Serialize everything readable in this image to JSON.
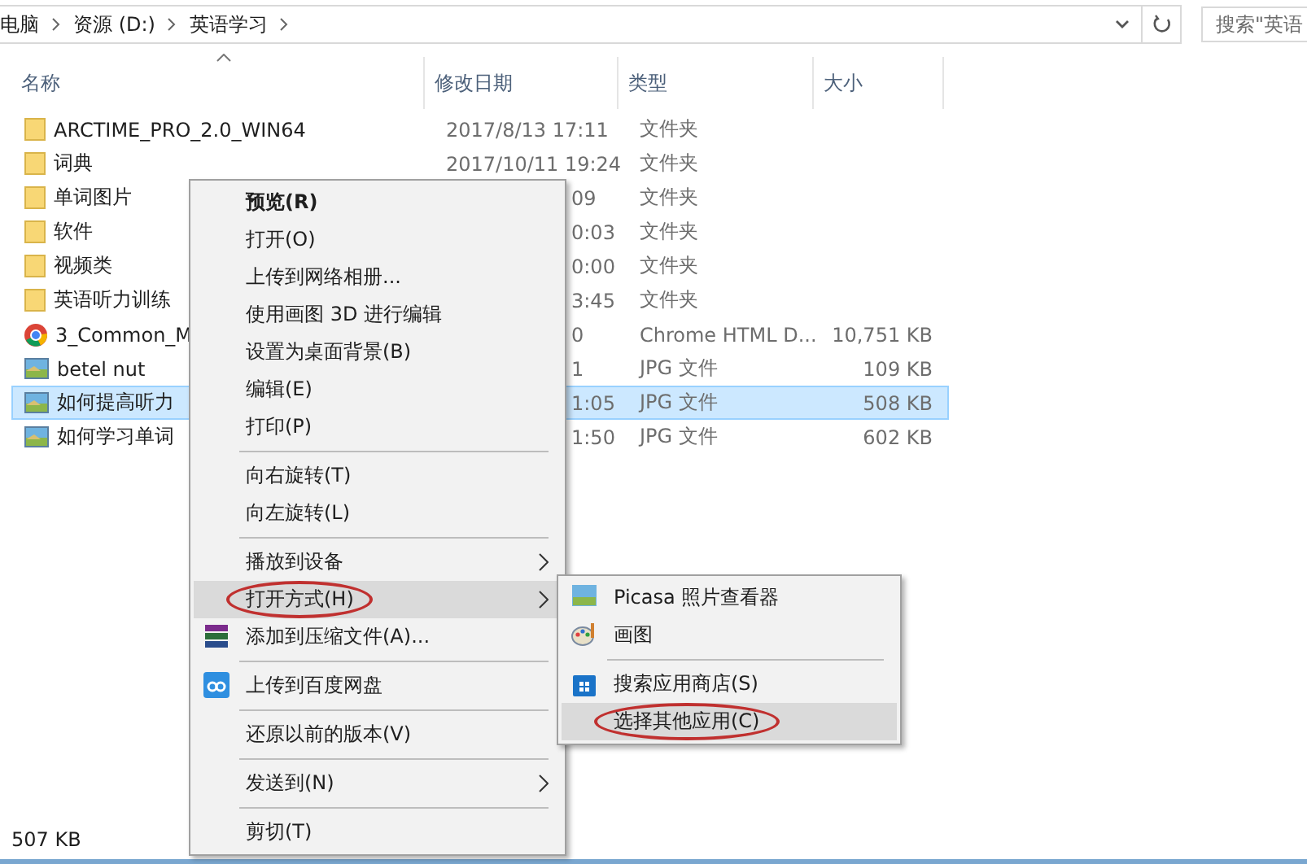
{
  "address_bar": {
    "path": [
      "电脑",
      "资源 (D:)",
      "英语学习"
    ]
  },
  "search": {
    "placeholder": "搜索\"英语"
  },
  "columns": [
    {
      "label": "名称",
      "sorted": true
    },
    {
      "label": "修改日期",
      "sorted": false
    },
    {
      "label": "类型",
      "sorted": false
    },
    {
      "label": "大小",
      "sorted": false
    }
  ],
  "files": [
    {
      "kind": "folder",
      "name": "ARCTIME_PRO_2.0_WIN64",
      "date": "2017/8/13 17:11",
      "type": "文件夹",
      "selected": false
    },
    {
      "kind": "folder",
      "name": "词典",
      "date": "2017/10/11 19:24",
      "type": "文件夹",
      "selected": false
    },
    {
      "kind": "folder",
      "name": "单词图片",
      "date": "09",
      "type": "文件夹",
      "selected": false
    },
    {
      "kind": "folder",
      "name": "软件",
      "date": "0:03",
      "type": "文件夹",
      "selected": false
    },
    {
      "kind": "folder",
      "name": "视频类",
      "date": "0:00",
      "type": "文件夹",
      "selected": false
    },
    {
      "kind": "folder",
      "name": "英语听力训练",
      "date": "3:45",
      "type": "文件夹",
      "selected": false
    },
    {
      "kind": "chrome",
      "name": "3_Common_M",
      "date": "0",
      "type": "Chrome HTML D...",
      "size": "10,751 KB",
      "selected": false
    },
    {
      "kind": "image",
      "name": "betel nut",
      "date": "1",
      "type": "JPG 文件",
      "size": "109 KB",
      "selected": false
    },
    {
      "kind": "image",
      "name": "如何提高听力",
      "date": "1:05",
      "type": "JPG 文件",
      "size": "508 KB",
      "selected": true
    },
    {
      "kind": "image",
      "name": "如何学习单词",
      "date": "1:50",
      "type": "JPG 文件",
      "size": "602 KB",
      "selected": false
    }
  ],
  "status_bar": {
    "text": "507 KB"
  },
  "context_menu": [
    {
      "kind": "item",
      "label": "预览(R)",
      "bold": true
    },
    {
      "kind": "item",
      "label": "打开(O)"
    },
    {
      "kind": "item",
      "label": "上传到网络相册..."
    },
    {
      "kind": "item",
      "label": "使用画图 3D 进行编辑"
    },
    {
      "kind": "item",
      "label": "设置为桌面背景(B)"
    },
    {
      "kind": "item",
      "label": "编辑(E)"
    },
    {
      "kind": "item",
      "label": "打印(P)"
    },
    {
      "kind": "separator"
    },
    {
      "kind": "item",
      "label": "向右旋转(T)"
    },
    {
      "kind": "item",
      "label": "向左旋转(L)"
    },
    {
      "kind": "separator"
    },
    {
      "kind": "item",
      "label": "播放到设备",
      "submenu": true
    },
    {
      "kind": "item",
      "label": "打开方式(H)",
      "submenu": true,
      "selected": true,
      "circled": true
    },
    {
      "kind": "archive",
      "label": "添加到压缩文件(A)..."
    },
    {
      "kind": "separator"
    },
    {
      "kind": "cloud",
      "label": "上传到百度网盘"
    },
    {
      "kind": "separator"
    },
    {
      "kind": "item",
      "label": "还原以前的版本(V)"
    },
    {
      "kind": "separator"
    },
    {
      "kind": "item",
      "label": "发送到(N)",
      "submenu": true
    },
    {
      "kind": "separator"
    },
    {
      "kind": "item",
      "label": "剪切(T)"
    }
  ],
  "submenu": [
    {
      "kind": "image",
      "label": "Picasa 照片查看器"
    },
    {
      "kind": "palette",
      "label": "画图"
    },
    {
      "kind": "separator"
    },
    {
      "kind": "store",
      "label": "搜索应用商店(S)"
    },
    {
      "kind": "item",
      "label": "选择其他应用(C)",
      "selected": true,
      "circled": true
    }
  ]
}
